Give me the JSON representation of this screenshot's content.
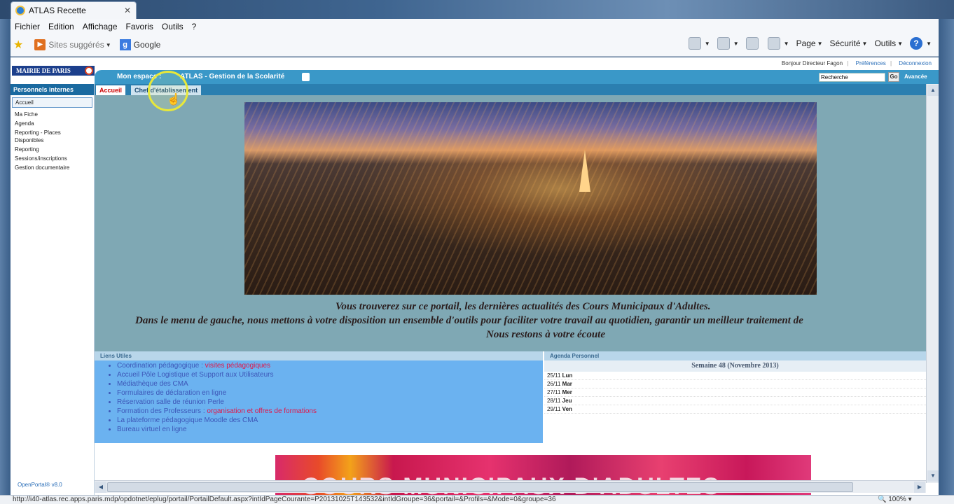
{
  "browser": {
    "tab_title": "ATLAS Recette",
    "menu": [
      "Fichier",
      "Edition",
      "Affichage",
      "Favoris",
      "Outils",
      "?"
    ],
    "favorites": {
      "suggested_sites": "Sites suggérés",
      "google": "Google"
    },
    "commands": {
      "page": "Page",
      "security": "Sécurité",
      "tools": "Outils"
    },
    "status_url": "http://i40-atlas.rec.apps.paris.mdp/opdotnet/eplug/portail/PortailDefault.aspx?intIdPageCourante=P20131025T143532&intIdGroupe=36&portail=&Profils=&Mode=0&groupe=36",
    "zoom": "100%"
  },
  "portal": {
    "logo": "MAIRIE DE PARIS",
    "greeting": "Bonjour Directeur Fagon",
    "preferences": "Préférences",
    "logout": "Déconnexion",
    "header_space": "Mon espace :",
    "header_app": "ATLAS - Gestion de la Scolarité",
    "search_placeholder": "Recherche",
    "search_button": "Go",
    "advanced": "Avancée",
    "tabs": [
      "Accueil",
      "Chef d'établissement"
    ]
  },
  "leftnav": {
    "heading": "Personnels internes",
    "items": [
      "Accueil",
      "Ma Fiche",
      "Agenda",
      "Reporting - Places Disponibles",
      "Reporting",
      "Sessions/inscriptions",
      "Gestion documentaire"
    ],
    "footer": "OpenPortal® v8.0"
  },
  "hero": {
    "line1": "Vous trouverez sur ce portail, les dernières actualités des Cours Municipaux d'Adultes.",
    "line2": "Dans le menu de gauche, nous mettons à votre disposition un ensemble d'outils pour faciliter votre travail au quotidien, garantir un meilleur traitement de",
    "line3": "Nous restons à votre écoute"
  },
  "links": {
    "heading": "Liens Utiles",
    "items": [
      {
        "text": "Coordination pédagogique : ",
        "highlight": "visites pédagogiques"
      },
      {
        "text": "Accueil Pôle Logistique et Support aux Utilisateurs",
        "highlight": ""
      },
      {
        "text": "Médiathèque des CMA",
        "highlight": ""
      },
      {
        "text": "Formulaires  de déclaration en ligne",
        "highlight": ""
      },
      {
        "text": "Réservation  salle de réunion Perle",
        "highlight": ""
      },
      {
        "text": "Formation des Professeurs : ",
        "highlight": "organisation et offres de formations"
      },
      {
        "text": "La plateforme pédagogique Moodle des CMA",
        "highlight": ""
      },
      {
        "text": "Bureau virtuel en ligne",
        "highlight": ""
      }
    ]
  },
  "agenda": {
    "heading": "Agenda Personnel",
    "week": "Semaine 48 (Novembre 2013)",
    "days": [
      {
        "date": "25/11",
        "day": "Lun"
      },
      {
        "date": "26/11",
        "day": "Mar"
      },
      {
        "date": "27/11",
        "day": "Mer"
      },
      {
        "date": "28/11",
        "day": "Jeu"
      },
      {
        "date": "29/11",
        "day": "Ven"
      }
    ]
  },
  "banner": {
    "text": "COURS MUNICIPAUX D'ADULTES"
  }
}
